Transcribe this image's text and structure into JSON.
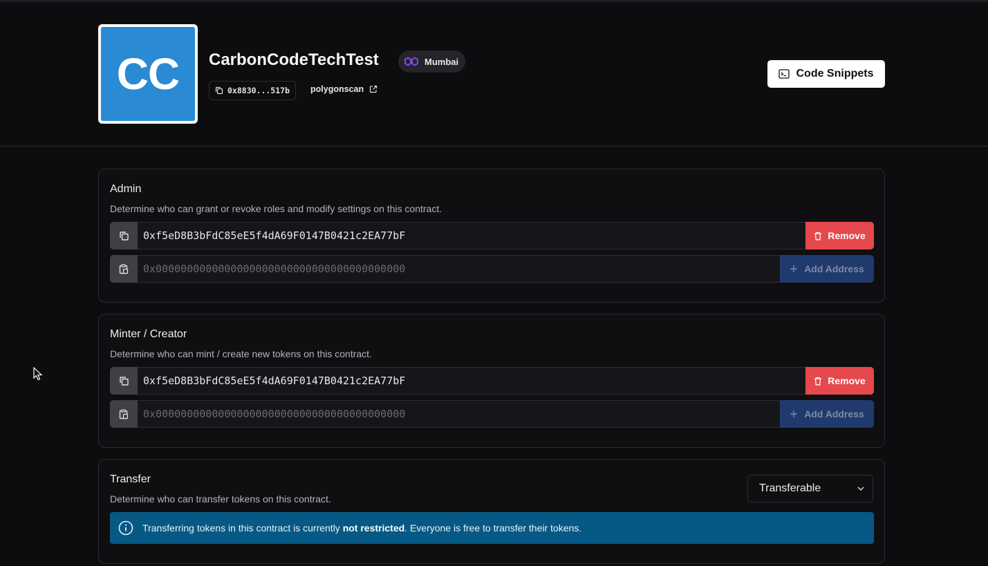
{
  "header": {
    "logo_text": "CC",
    "title": "CarbonCodeTechTest",
    "network": "Mumbai",
    "contract_address": "0x8830...517b",
    "explorer": "polygonscan",
    "code_snippets_label": "Code Snippets"
  },
  "admin": {
    "title": "Admin",
    "description": "Determine who can grant or revoke roles and modify settings on this contract.",
    "address": "0xf5eD8B3bFdC85eE5f4dA69F0147B0421c2EA77bF",
    "remove_label": "Remove",
    "new_placeholder": "0x0000000000000000000000000000000000000000",
    "add_label": "Add Address"
  },
  "minter": {
    "title": "Minter / Creator",
    "description": "Determine who can mint / create new tokens on this contract.",
    "address": "0xf5eD8B3bFdC85eE5f4dA69F0147B0421c2EA77bF",
    "remove_label": "Remove",
    "new_placeholder": "0x0000000000000000000000000000000000000000",
    "add_label": "Add Address"
  },
  "transfer": {
    "title": "Transfer",
    "description": "Determine who can transfer tokens on this contract.",
    "select_value": "Transferable",
    "alert_prefix": "Transferring tokens in this contract is currently ",
    "alert_bold": "not restricted",
    "alert_suffix": ". Everyone is free to transfer their tokens."
  },
  "colors": {
    "background": "#0d0d0f",
    "remove": "#e5484d",
    "add": "#213a6e",
    "alert": "#075985",
    "logo": "#2a8ad4",
    "polygon": "#8247e5"
  }
}
